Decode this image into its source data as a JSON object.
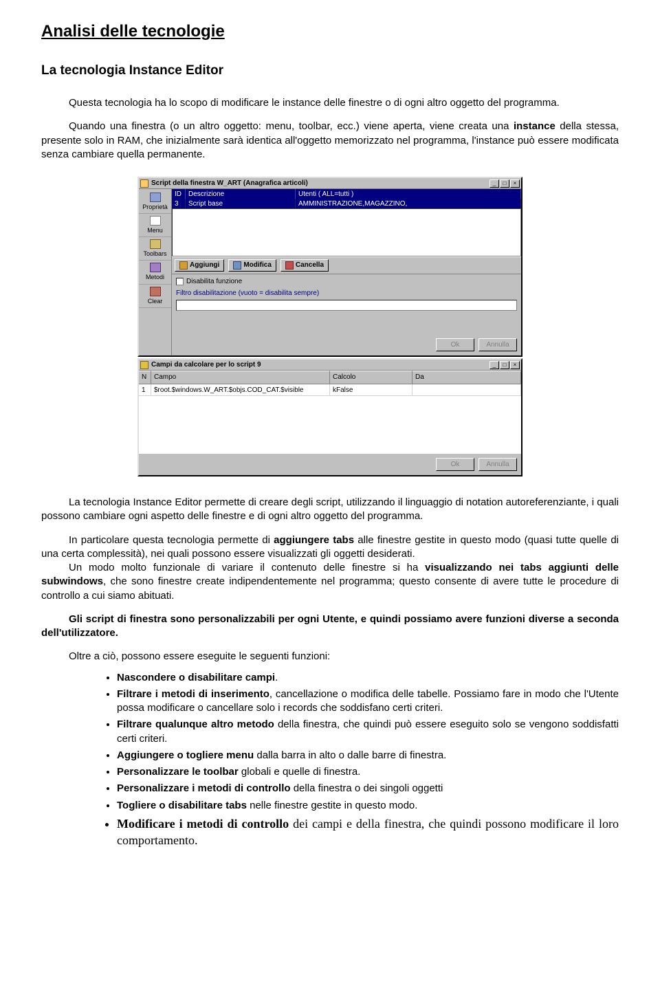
{
  "title": "Analisi delle tecnologie",
  "subtitle": "La tecnologia Instance Editor",
  "para1": "Questa tecnologia  ha lo scopo di modificare le instance delle finestre o di ogni altro oggetto del programma.",
  "para2a": "Quando una finestra (o un altro oggetto: menu, toolbar, ecc.) viene aperta, viene creata una ",
  "para2b": "instance",
  "para2c": " della stessa, presente solo in RAM, che inizialmente sarà identica all'oggetto memorizzato nel programma, l'instance può essere modificata senza cambiare quella permanente.",
  "screenshot": {
    "win1": {
      "title": "Script della finestra W_ART   (Anagrafica articoli)",
      "sidebar": [
        "Proprietà",
        "Menu",
        "Toolbars",
        "Metodi",
        "Clear"
      ],
      "head": {
        "c1": "ID",
        "c2": "Descrizione",
        "c3": "Utenti ( ALL=tutti )"
      },
      "row": {
        "c1": "3",
        "c2": "Script base",
        "c3": "AMMINISTRAZIONE,MAGAZZINO,"
      },
      "tb_add": "Aggiungi",
      "tb_mod": "Modifica",
      "tb_del": "Cancella",
      "chk_label": "Disabilita funzione",
      "filter_label": "Filtro disabilitazione (vuoto = disabilita sempre)",
      "btn_ok": "Ok",
      "btn_cancel": "Annulla"
    },
    "win2": {
      "title": "Campi da calcolare per lo script 9",
      "head": {
        "c1": "N",
        "c2": "Campo",
        "c3": "Calcolo",
        "c4": "Da"
      },
      "row": {
        "c1": "1",
        "c2": "$root.$windows.W_ART.$objs.COD_CAT.$visible",
        "c3": "kFalse",
        "c4": ""
      },
      "btn_ok": "Ok",
      "btn_cancel": "Annulla"
    }
  },
  "para3": "La tecnologia Instance Editor permette di creare degli script, utilizzando il linguaggio di notation autoreferenziante, i quali possono cambiare ogni aspetto delle finestre e di ogni altro oggetto del programma.",
  "para4a": "In particolare questa tecnologia permette di ",
  "para4b": "aggiungere tabs",
  "para4c": " alle finestre gestite in questo modo (quasi tutte quelle di una certa complessità), nei quali possono essere visualizzati gli oggetti desiderati.",
  "para5a": "Un modo molto funzionale di variare il contenuto delle finestre si ha ",
  "para5b": "visualizzando nei tabs aggiunti delle subwindows",
  "para5c": ", che sono finestre create indipendentemente nel programma; questo consente di avere tutte le procedure di controllo a cui siamo abituati.",
  "para6": "Gli script di finestra sono personalizzabili per ogni Utente, e quindi possiamo avere funzioni diverse a seconda dell'utilizzatore.",
  "para7": "Oltre a ciò, possono essere eseguite le seguenti funzioni:",
  "bullets": [
    {
      "strong": "Nascondere o disabilitare campi",
      "rest": "."
    },
    {
      "strong": "Filtrare i metodi di inserimento",
      "rest": ", cancellazione o modifica delle tabelle. Possiamo fare in modo che l'Utente possa modificare o cancellare solo i records che soddisfano certi criteri."
    },
    {
      "strong": "Filtrare qualunque altro metodo",
      "rest": " della finestra, che quindi può essere eseguito solo se vengono soddisfatti certi criteri."
    },
    {
      "strong": "Aggiungere o togliere menu",
      "rest": " dalla barra in alto o dalle barre di finestra."
    },
    {
      "strong": "Personalizzare le toolbar",
      "rest": " globali e quelle di finestra."
    },
    {
      "strong": "Personalizzare i metodi di controllo",
      "rest": " della finestra o dei singoli oggetti"
    },
    {
      "strong": "Togliere o disabilitare tabs",
      "rest": " nelle finestre gestite in questo modo."
    }
  ],
  "bullet_last": {
    "strong": "Modificare i metodi di controllo",
    "rest": " dei campi e della finestra, che quindi possono modificare il loro comportamento."
  }
}
